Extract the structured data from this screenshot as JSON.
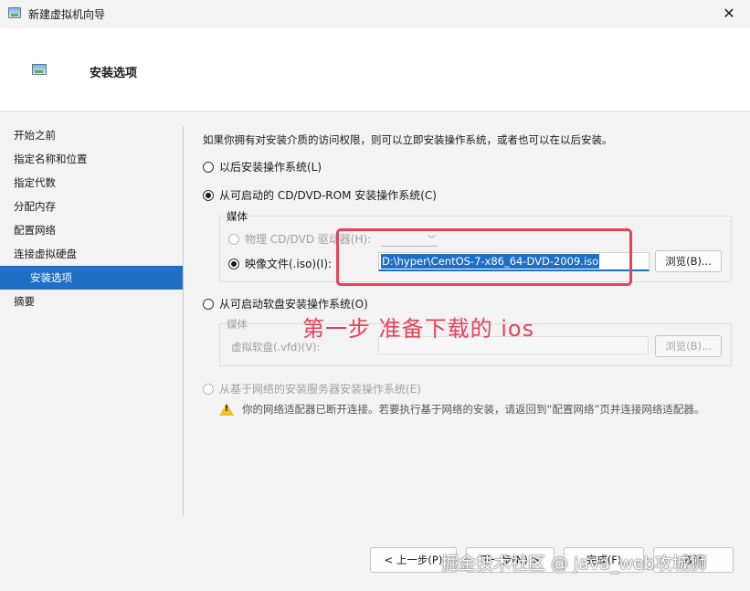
{
  "window": {
    "title": "新建虚拟机向导"
  },
  "header": {
    "title": "安装选项"
  },
  "sidebar": {
    "items": [
      {
        "label": "开始之前"
      },
      {
        "label": "指定名称和位置"
      },
      {
        "label": "指定代数"
      },
      {
        "label": "分配内存"
      },
      {
        "label": "配置网络"
      },
      {
        "label": "连接虚拟硬盘"
      },
      {
        "label": "安装选项"
      },
      {
        "label": "摘要"
      }
    ]
  },
  "main": {
    "intro": "如果你拥有对安装介质的访问权限，则可以立即安装操作系统，或者也可以在以后安装。",
    "option_later": "以后安装操作系统(L)",
    "option_cd": "从可启动的 CD/DVD-ROM 安装操作系统(C)",
    "media_group": "媒体",
    "physical_drive": "物理 CD/DVD 驱动器(H):",
    "image_file": "映像文件(.iso)(I):",
    "iso_path": "D:\\hyper\\CentOS-7-x86_64-DVD-2009.iso",
    "browse": "浏览(B)...",
    "option_floppy": "从可启动软盘安装操作系统(O)",
    "floppy_media_group": "媒体",
    "vfd_label": "虚拟软盘(.vfd)(V):",
    "browse_disabled": "浏览(B)...",
    "option_network": "从基于网络的安装服务器安装操作系统(E)",
    "network_warning": "你的网络适配器已断开连接。若要执行基于网络的安装，请返回到“配置网络”页并连接网络适配器。"
  },
  "annotation": {
    "text": "第一步  准备下载的 ios"
  },
  "footer": {
    "prev": "< 上一步(P)",
    "next": "下一步(N) >",
    "finish": "完成(F)",
    "cancel": "取消"
  },
  "watermark": {
    "text": "掘金技术社区 @ java_web攻城狮"
  }
}
